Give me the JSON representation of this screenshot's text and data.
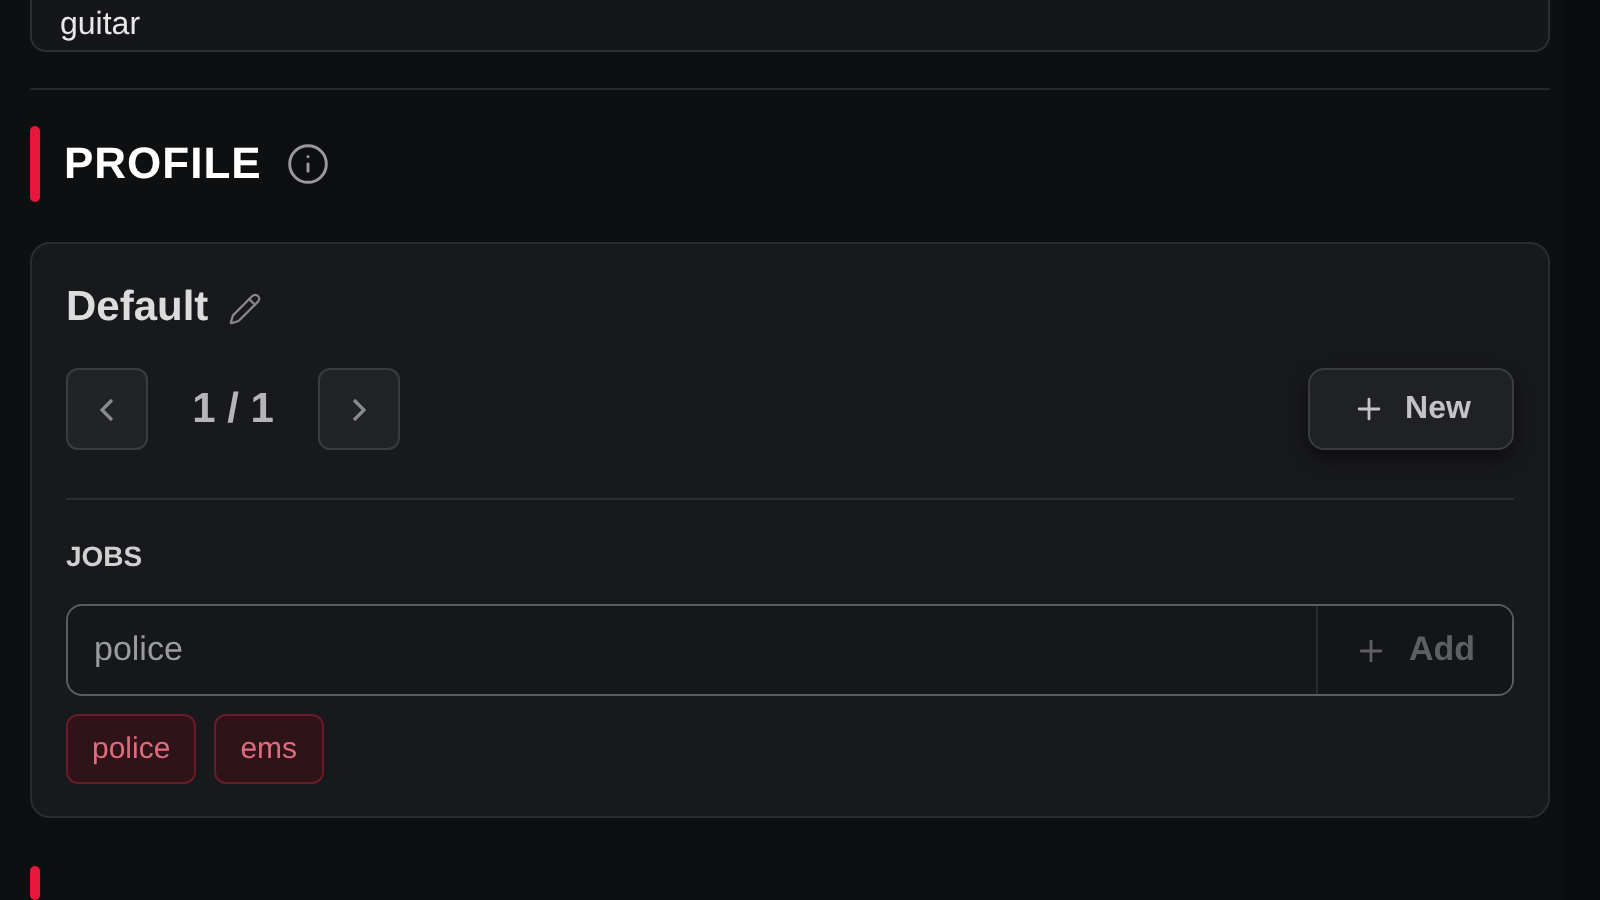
{
  "top_field": {
    "value": "guitar"
  },
  "section": {
    "title": "PROFILE"
  },
  "profile": {
    "name": "Default",
    "pager": "1 / 1",
    "new_button": "New",
    "jobs": {
      "label": "JOBS",
      "placeholder": "police",
      "add_button": "Add",
      "tags": [
        {
          "label": "police"
        },
        {
          "label": "ems"
        }
      ]
    }
  }
}
